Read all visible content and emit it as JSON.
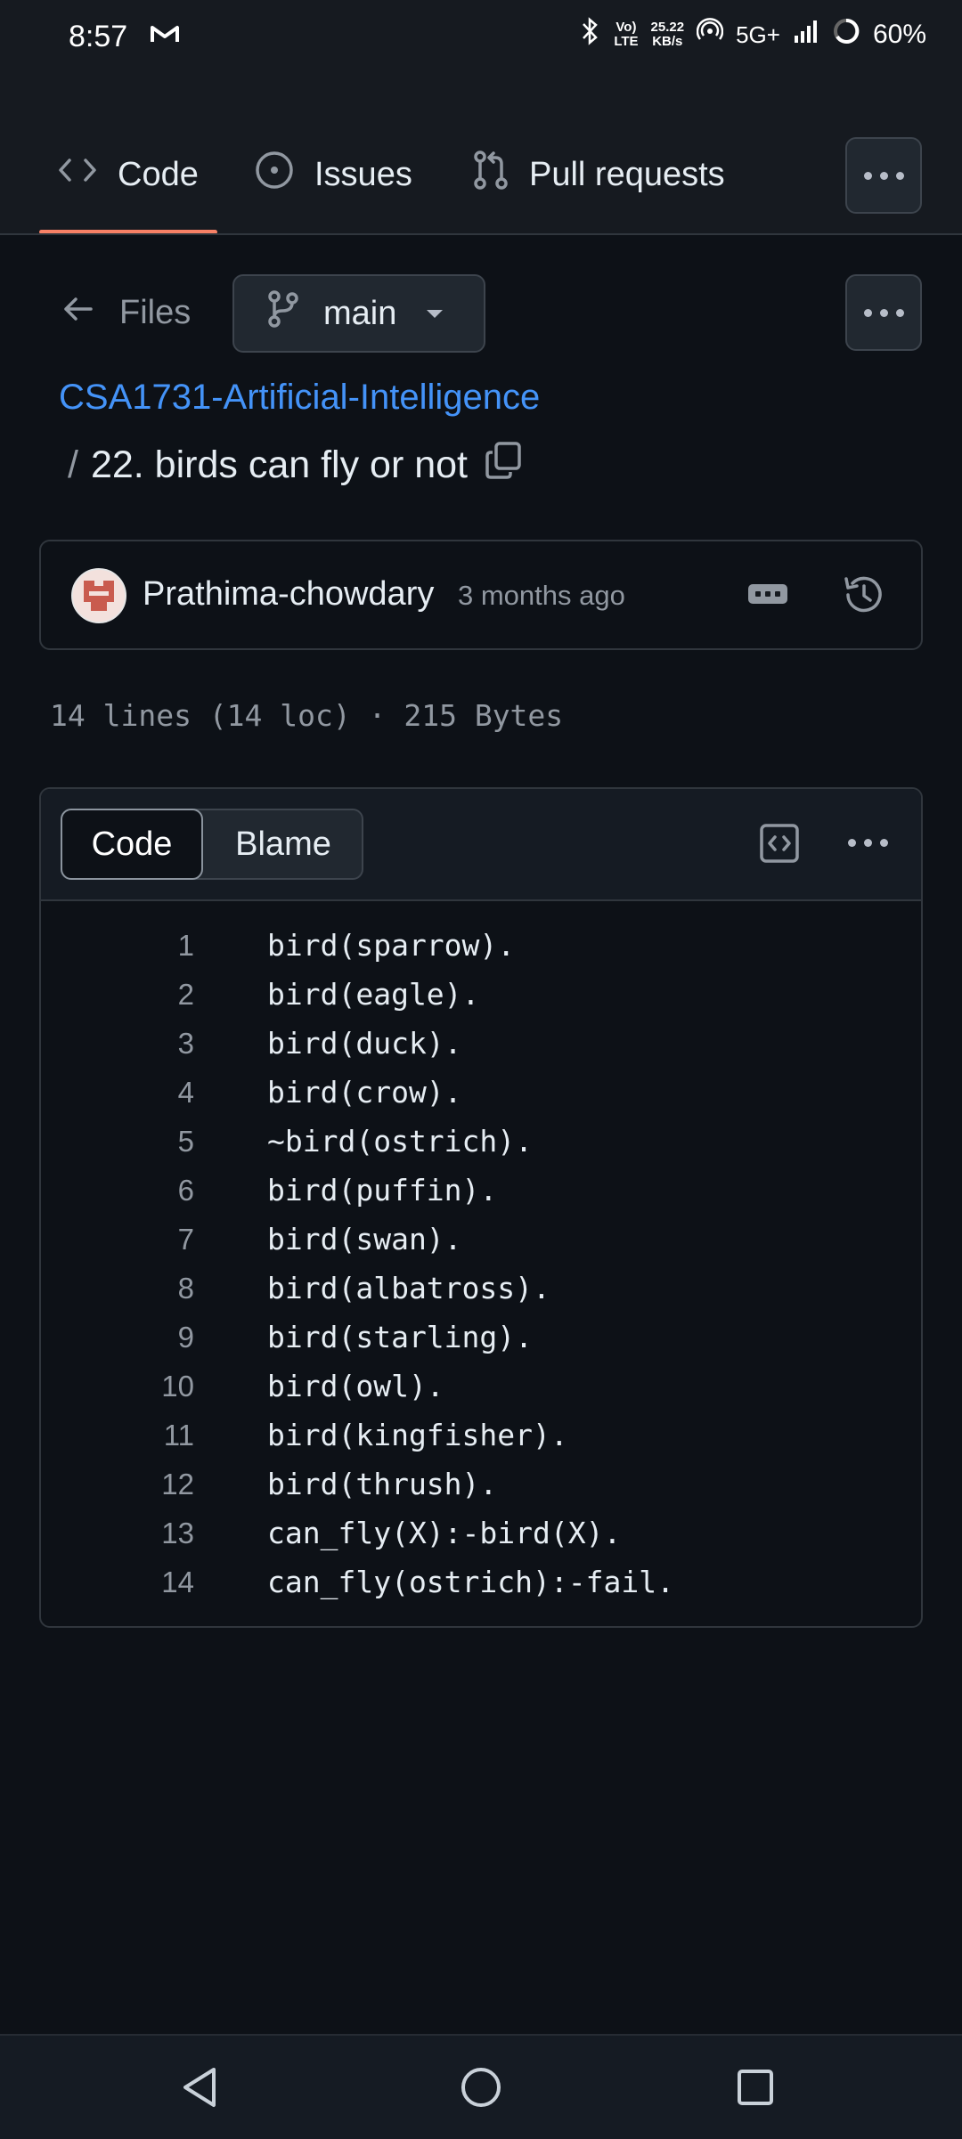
{
  "status_bar": {
    "time": "8:57",
    "volte_top": "Vo)",
    "volte_bottom": "LTE",
    "speed_top": "25.22",
    "speed_bottom": "KB/s",
    "network": "5G+",
    "battery": "60%"
  },
  "tabs": [
    {
      "label": "Code",
      "icon": "code-icon",
      "active": true
    },
    {
      "label": "Issues",
      "icon": "issue-opened-icon",
      "active": false
    },
    {
      "label": "Pull requests",
      "icon": "git-pull-request-icon",
      "active": false
    }
  ],
  "files_row": {
    "files_label": "Files",
    "branch": "main"
  },
  "breadcrumb": {
    "repo": "CSA1731-Artificial-Intelligence",
    "separator": "/",
    "file": "22. birds can fly or not"
  },
  "commit": {
    "author": "Prathima-chowdary",
    "time": "3 months ago"
  },
  "file_meta": "14 lines (14 loc) · 215 Bytes",
  "code_view": {
    "tab_code": "Code",
    "tab_blame": "Blame"
  },
  "code": [
    {
      "n": "1",
      "text": "bird(sparrow)."
    },
    {
      "n": "2",
      "text": "bird(eagle)."
    },
    {
      "n": "3",
      "text": "bird(duck)."
    },
    {
      "n": "4",
      "text": "bird(crow)."
    },
    {
      "n": "5",
      "text": "~bird(ostrich)."
    },
    {
      "n": "6",
      "text": "bird(puffin)."
    },
    {
      "n": "7",
      "text": "bird(swan)."
    },
    {
      "n": "8",
      "text": "bird(albatross)."
    },
    {
      "n": "9",
      "text": "bird(starling)."
    },
    {
      "n": "10",
      "text": "bird(owl)."
    },
    {
      "n": "11",
      "text": "bird(kingfisher)."
    },
    {
      "n": "12",
      "text": "bird(thrush)."
    },
    {
      "n": "13",
      "text": "can_fly(X):-bird(X)."
    },
    {
      "n": "14",
      "text": "can_fly(ostrich):-fail."
    }
  ],
  "colors": {
    "background": "#0d1117",
    "link": "#4493f8",
    "active_tab_underline": "#f78166",
    "muted_text": "#9198a1"
  }
}
